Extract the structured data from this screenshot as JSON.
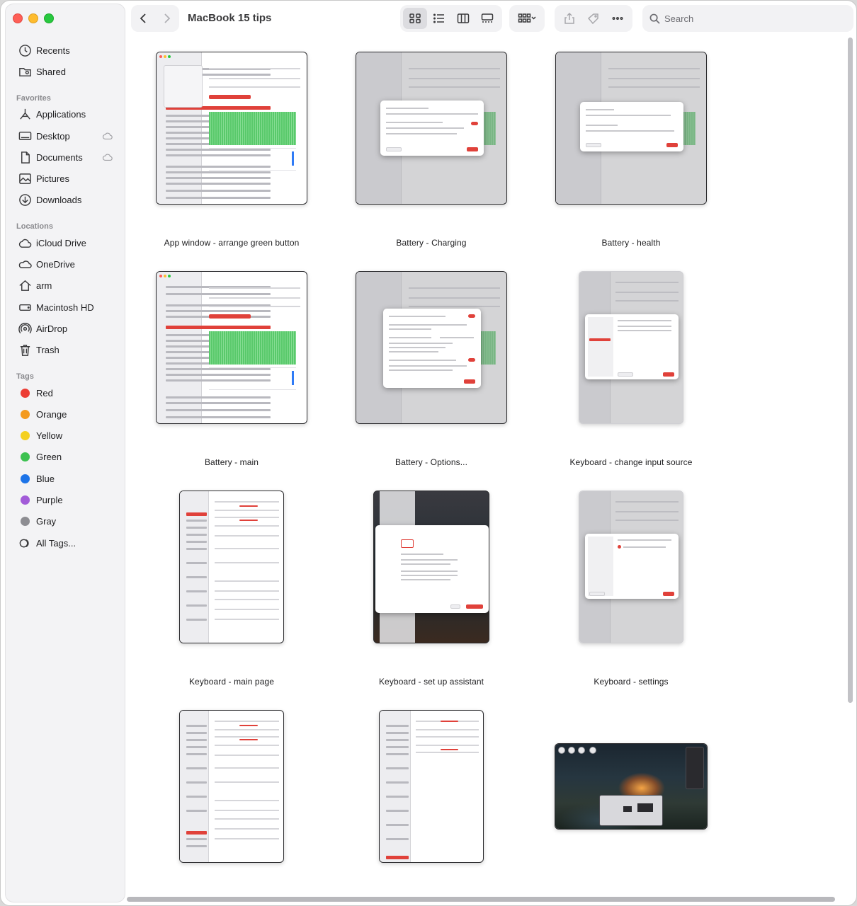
{
  "window": {
    "title": "MacBook 15 tips"
  },
  "sidebar": {
    "recents": [
      {
        "label": "Recents",
        "icon": "clock-icon"
      },
      {
        "label": "Shared",
        "icon": "shared-folder-icon"
      }
    ],
    "favorites_header": "Favorites",
    "favorites": [
      {
        "label": "Applications",
        "icon": "applications-icon"
      },
      {
        "label": "Desktop",
        "icon": "desktop-icon"
      },
      {
        "label": "Documents",
        "icon": "document-icon"
      },
      {
        "label": "Pictures",
        "icon": "pictures-icon"
      },
      {
        "label": "Downloads",
        "icon": "downloads-icon"
      }
    ],
    "locations_header": "Locations",
    "locations": [
      {
        "label": "iCloud Drive",
        "icon": "icloud-icon"
      },
      {
        "label": "OneDrive",
        "icon": "onedrive-icon"
      },
      {
        "label": "arm",
        "icon": "home-icon"
      },
      {
        "label": "Macintosh HD",
        "icon": "disk-icon"
      },
      {
        "label": "AirDrop",
        "icon": "airdrop-icon"
      },
      {
        "label": "Trash",
        "icon": "trash-icon"
      }
    ],
    "tags_header": "Tags",
    "tags": [
      {
        "label": "Red",
        "color": "#ec3c34"
      },
      {
        "label": "Orange",
        "color": "#f39a1f"
      },
      {
        "label": "Yellow",
        "color": "#f4d01f"
      },
      {
        "label": "Green",
        "color": "#3cc150"
      },
      {
        "label": "Blue",
        "color": "#1d74e8"
      },
      {
        "label": "Purple",
        "color": "#a25bd8"
      },
      {
        "label": "Gray",
        "color": "#8d8d92"
      }
    ],
    "all_tags": "All Tags..."
  },
  "toolbar": {
    "search_placeholder": "Search",
    "view_icons": [
      "grid-view-icon",
      "list-view-icon",
      "column-view-icon",
      "gallery-view-icon"
    ],
    "group_icon": "group-by-icon",
    "share_icon": "share-icon",
    "tag_icon": "tag-icon",
    "more_icon": "more-icon"
  },
  "files": [
    {
      "name": "App window - arrange green button"
    },
    {
      "name": "Battery - Charging"
    },
    {
      "name": "Battery - health"
    },
    {
      "name": "Battery - main"
    },
    {
      "name": "Battery - Options..."
    },
    {
      "name": "Keyboard - change input source"
    },
    {
      "name": "Keyboard - main page"
    },
    {
      "name": "Keyboard - set up assistant"
    },
    {
      "name": "Keyboard - settings"
    },
    {
      "name": ""
    },
    {
      "name": ""
    },
    {
      "name": ""
    }
  ]
}
